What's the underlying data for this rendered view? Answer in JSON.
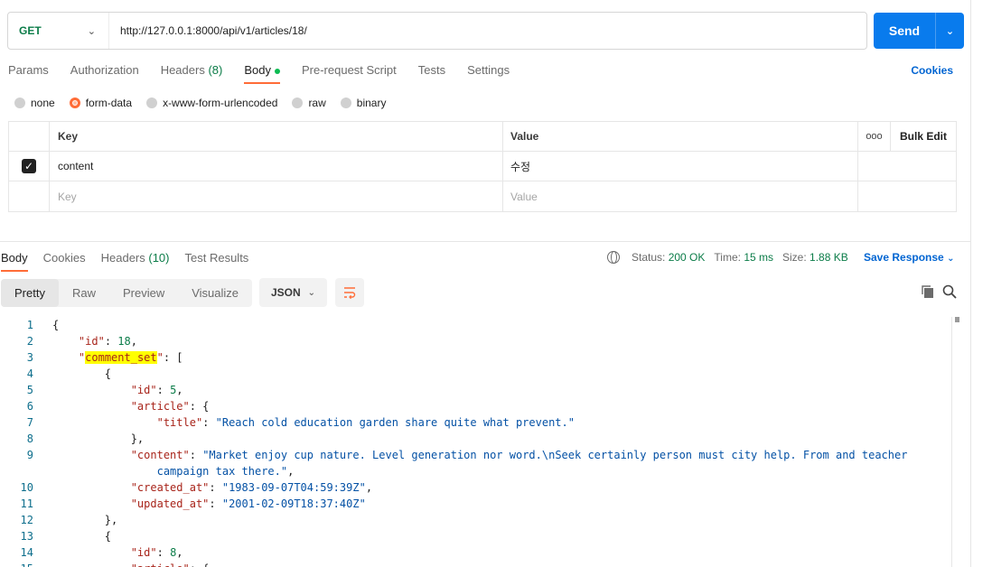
{
  "request": {
    "method": "GET",
    "url": "http://127.0.0.1:8000/api/v1/articles/18/",
    "send_label": "Send"
  },
  "request_tabs": [
    {
      "label": "Params"
    },
    {
      "label": "Authorization"
    },
    {
      "label": "Headers",
      "count": "(8)"
    },
    {
      "label": "Body"
    },
    {
      "label": "Pre-request Script"
    },
    {
      "label": "Tests"
    },
    {
      "label": "Settings"
    }
  ],
  "cookies_label": "Cookies",
  "body_types": [
    "none",
    "form-data",
    "x-www-form-urlencoded",
    "raw",
    "binary"
  ],
  "body_type_selected": "form-data",
  "form_table": {
    "headers": {
      "key": "Key",
      "value": "Value",
      "bulk_edit": "Bulk Edit",
      "more": "ooo"
    },
    "rows": [
      {
        "key": "content",
        "value": "수정",
        "checked": true
      }
    ],
    "placeholder": {
      "key": "Key",
      "value": "Value"
    }
  },
  "response_tabs": [
    {
      "label": "Body"
    },
    {
      "label": "Cookies"
    },
    {
      "label": "Headers",
      "count": "(10)"
    },
    {
      "label": "Test Results"
    }
  ],
  "response_meta": {
    "status_label": "Status:",
    "status_value": "200 OK",
    "time_label": "Time:",
    "time_value": "15 ms",
    "size_label": "Size:",
    "size_value": "1.88 KB",
    "save_response": "Save Response"
  },
  "format_buttons": [
    "Pretty",
    "Raw",
    "Preview",
    "Visualize"
  ],
  "format_selected": "Pretty",
  "language": "JSON",
  "code_lines": [
    {
      "n": "1",
      "indent": 0,
      "parts": [
        {
          "t": "p",
          "v": "{"
        }
      ]
    },
    {
      "n": "2",
      "indent": 1,
      "parts": [
        {
          "t": "k",
          "v": "\"id\""
        },
        {
          "t": "p",
          "v": ": "
        },
        {
          "t": "n",
          "v": "18"
        },
        {
          "t": "p",
          "v": ","
        }
      ]
    },
    {
      "n": "3",
      "indent": 1,
      "parts": [
        {
          "t": "k",
          "v": "\""
        },
        {
          "t": "hl",
          "v": "comment_set"
        },
        {
          "t": "k",
          "v": "\""
        },
        {
          "t": "p",
          "v": ": ["
        }
      ]
    },
    {
      "n": "4",
      "indent": 2,
      "parts": [
        {
          "t": "p",
          "v": "{"
        }
      ]
    },
    {
      "n": "5",
      "indent": 3,
      "parts": [
        {
          "t": "k",
          "v": "\"id\""
        },
        {
          "t": "p",
          "v": ": "
        },
        {
          "t": "n",
          "v": "5"
        },
        {
          "t": "p",
          "v": ","
        }
      ]
    },
    {
      "n": "6",
      "indent": 3,
      "parts": [
        {
          "t": "k",
          "v": "\"article\""
        },
        {
          "t": "p",
          "v": ": {"
        }
      ]
    },
    {
      "n": "7",
      "indent": 4,
      "parts": [
        {
          "t": "k",
          "v": "\"title\""
        },
        {
          "t": "p",
          "v": ": "
        },
        {
          "t": "s",
          "v": "\"Reach cold education garden share quite what prevent.\""
        }
      ]
    },
    {
      "n": "8",
      "indent": 3,
      "parts": [
        {
          "t": "p",
          "v": "},"
        }
      ]
    },
    {
      "n": "9",
      "indent": 3,
      "parts": [
        {
          "t": "k",
          "v": "\"content\""
        },
        {
          "t": "p",
          "v": ": "
        },
        {
          "t": "s",
          "v": "\"Market enjoy cup nature. Level generation nor word.\\nSeek certainly person must city help. From and teacher"
        }
      ]
    },
    {
      "n": "",
      "indent": 4,
      "parts": [
        {
          "t": "s",
          "v": "campaign tax there.\""
        },
        {
          "t": "p",
          "v": ","
        }
      ]
    },
    {
      "n": "10",
      "indent": 3,
      "parts": [
        {
          "t": "k",
          "v": "\"created_at\""
        },
        {
          "t": "p",
          "v": ": "
        },
        {
          "t": "s",
          "v": "\"1983-09-07T04:59:39Z\""
        },
        {
          "t": "p",
          "v": ","
        }
      ]
    },
    {
      "n": "11",
      "indent": 3,
      "parts": [
        {
          "t": "k",
          "v": "\"updated_at\""
        },
        {
          "t": "p",
          "v": ": "
        },
        {
          "t": "s",
          "v": "\"2001-02-09T18:37:40Z\""
        }
      ]
    },
    {
      "n": "12",
      "indent": 2,
      "parts": [
        {
          "t": "p",
          "v": "},"
        }
      ]
    },
    {
      "n": "13",
      "indent": 2,
      "parts": [
        {
          "t": "p",
          "v": "{"
        }
      ]
    },
    {
      "n": "14",
      "indent": 3,
      "parts": [
        {
          "t": "k",
          "v": "\"id\""
        },
        {
          "t": "p",
          "v": ": "
        },
        {
          "t": "n",
          "v": "8"
        },
        {
          "t": "p",
          "v": ","
        }
      ]
    },
    {
      "n": "15",
      "indent": 3,
      "parts": [
        {
          "t": "k",
          "v": "\"article\""
        },
        {
          "t": "p",
          "v": ": {"
        }
      ]
    }
  ]
}
